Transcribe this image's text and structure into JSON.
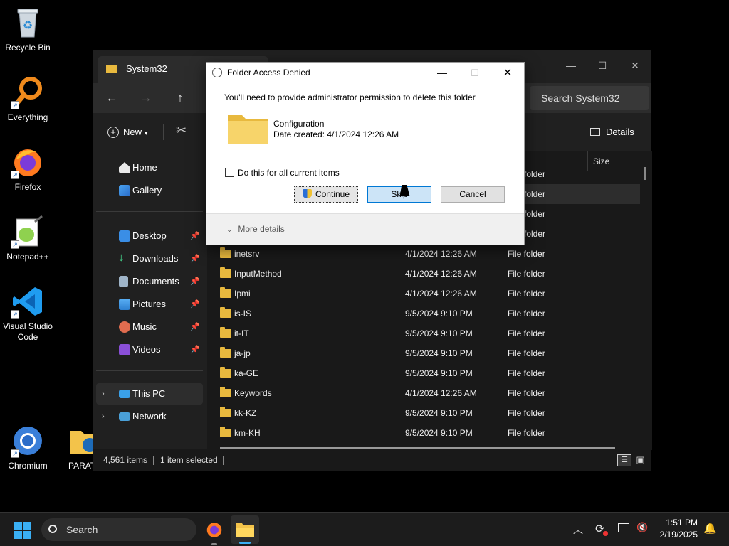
{
  "desktop": {
    "icons": [
      {
        "label": "Recycle Bin"
      },
      {
        "label": "Everything"
      },
      {
        "label": "Firefox"
      },
      {
        "label": "Notepad++"
      },
      {
        "label": "Visual Studio Code"
      },
      {
        "label": "Chromium"
      },
      {
        "label": "PARAT"
      }
    ]
  },
  "explorer": {
    "tab_title": "System32",
    "search_placeholder": "Search System32",
    "new_label": "New",
    "details_label": "Details",
    "columns": {
      "size": "Size"
    },
    "partial_type": "folder",
    "sidebar": {
      "home": "Home",
      "gallery": "Gallery",
      "desktop": "Desktop",
      "downloads": "Downloads",
      "documents": "Documents",
      "pictures": "Pictures",
      "music": "Music",
      "videos": "Videos",
      "this_pc": "This PC",
      "network": "Network"
    },
    "rows": [
      {
        "name": "inetsrv",
        "date": "4/1/2024 12:26 AM",
        "type": "File folder"
      },
      {
        "name": "InputMethod",
        "date": "4/1/2024 12:26 AM",
        "type": "File folder"
      },
      {
        "name": "Ipmi",
        "date": "4/1/2024 12:26 AM",
        "type": "File folder"
      },
      {
        "name": "is-IS",
        "date": "9/5/2024 9:10 PM",
        "type": "File folder"
      },
      {
        "name": "it-IT",
        "date": "9/5/2024 9:10 PM",
        "type": "File folder"
      },
      {
        "name": "ja-jp",
        "date": "9/5/2024 9:10 PM",
        "type": "File folder"
      },
      {
        "name": "ka-GE",
        "date": "9/5/2024 9:10 PM",
        "type": "File folder"
      },
      {
        "name": "Keywords",
        "date": "4/1/2024 12:26 AM",
        "type": "File folder"
      },
      {
        "name": "kk-KZ",
        "date": "9/5/2024 9:10 PM",
        "type": "File folder"
      },
      {
        "name": "km-KH",
        "date": "9/5/2024 9:10 PM",
        "type": "File folder"
      }
    ],
    "status": {
      "count": "4,561 items",
      "selected": "1 item selected"
    }
  },
  "dialog": {
    "title": "Folder Access Denied",
    "message": "You'll need to provide administrator permission to delete this folder",
    "folder_name": "Configuration",
    "date_created": "Date created: 4/1/2024 12:26 AM",
    "checkbox_label": "Do this for all current items",
    "continue_label": "Continue",
    "skip_label": "Skip",
    "cancel_label": "Cancel",
    "more_details": "More details"
  },
  "taskbar": {
    "search": "Search",
    "time": "1:51 PM",
    "date": "2/19/2025"
  },
  "colors": {
    "folder": "#e8b93e",
    "accent": "#0078d4",
    "taskbar": "#1c1c1c"
  }
}
